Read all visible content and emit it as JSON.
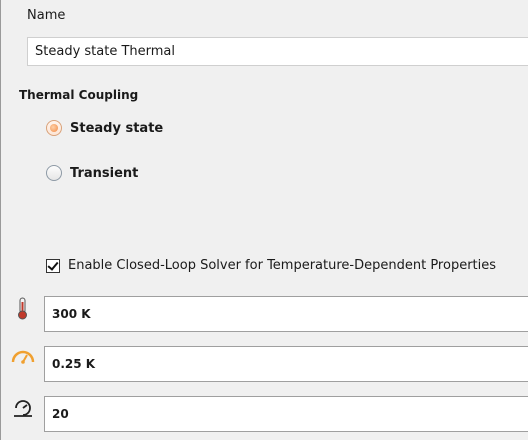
{
  "name": {
    "label": "Name",
    "value": "Steady state Thermal"
  },
  "thermal_coupling": {
    "title": "Thermal Coupling",
    "options": [
      {
        "label": "Steady state",
        "selected": true
      },
      {
        "label": "Transient",
        "selected": false
      }
    ]
  },
  "closed_loop": {
    "label": "Enable Closed-Loop Solver for Temperature-Dependent Properties",
    "checked": true
  },
  "parameters": [
    {
      "icon": "thermometer-icon",
      "value": "300 K"
    },
    {
      "icon": "gauge-icon",
      "value": "0.25 K"
    },
    {
      "icon": "iteration-icon",
      "value": "20"
    }
  ],
  "colors": {
    "selected_radio": "#f08a44",
    "thermometer": "#c0392b",
    "gauge": "#f0a030"
  }
}
